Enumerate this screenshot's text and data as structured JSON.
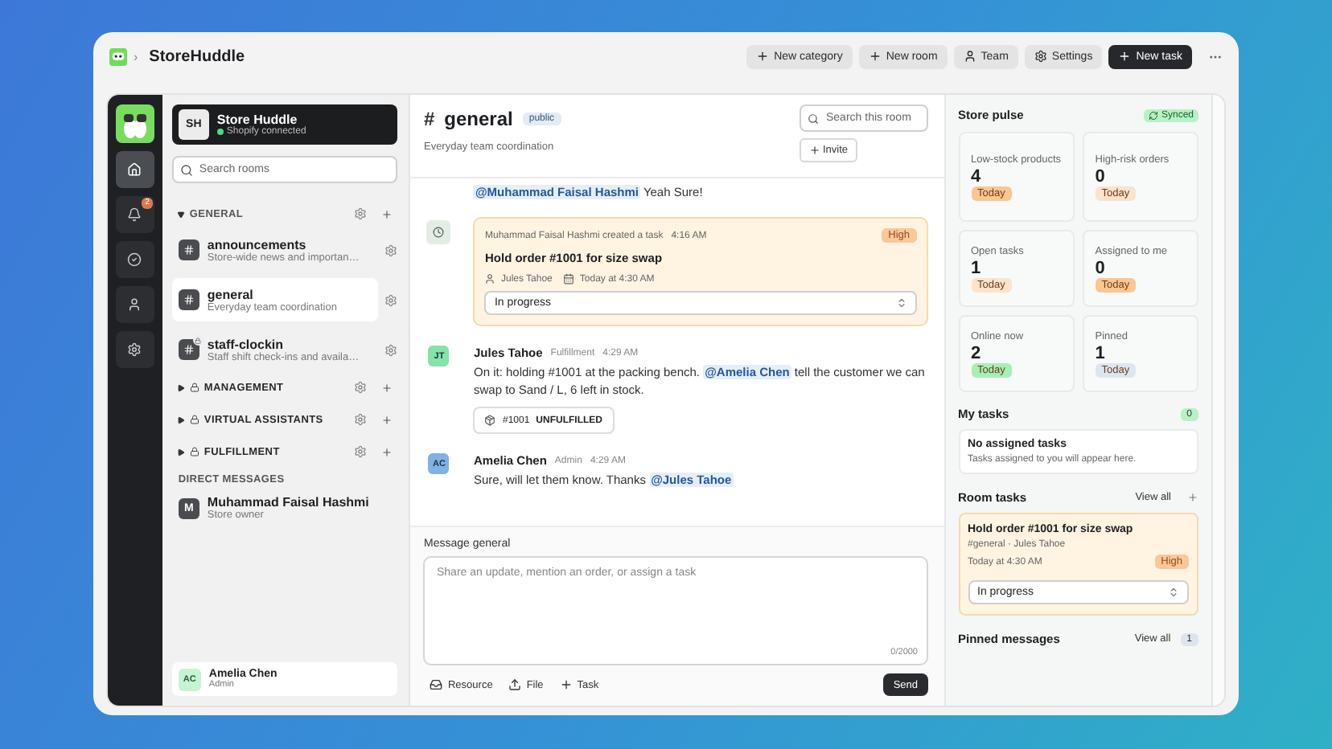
{
  "app": {
    "name": "StoreHuddle",
    "separator": "›"
  },
  "header_actions": [
    {
      "label": "New category",
      "kind": "secondary"
    },
    {
      "label": "New room",
      "kind": "secondary"
    },
    {
      "label": "Team",
      "kind": "secondary"
    },
    {
      "label": "Settings",
      "kind": "secondary"
    },
    {
      "label": "New task",
      "kind": "primary"
    }
  ],
  "rail": [
    {
      "selected": true
    },
    {
      "selected": false,
      "badge": "2"
    },
    {
      "selected": false
    },
    {
      "selected": false
    },
    {
      "selected": false
    }
  ],
  "workspace": {
    "initials": "SH",
    "name": "Store Huddle",
    "status": "Shopify connected",
    "connected": true
  },
  "sidebar": {
    "search_placeholder": "Search rooms",
    "categories": [
      {
        "name": "GENERAL",
        "expanded": true,
        "locked": false,
        "rooms": [
          {
            "name": "announcements",
            "description": "Store-wide news and importan…",
            "selected": false,
            "locked": false
          },
          {
            "name": "general",
            "description": "Everyday team coordination",
            "selected": true,
            "locked": false
          },
          {
            "name": "staff-clockin",
            "description": "Staff shift check-ins and availa…",
            "selected": false,
            "locked": true
          }
        ]
      },
      {
        "name": "MANAGEMENT",
        "expanded": false,
        "locked": true
      },
      {
        "name": "VIRTUAL ASSISTANTS",
        "expanded": false,
        "locked": true
      },
      {
        "name": "FULFILLMENT",
        "expanded": false,
        "locked": true
      }
    ],
    "dm_heading": "DIRECT MESSAGES",
    "dms": [
      {
        "initial": "M",
        "name": "Muhammad Faisal Hashmi",
        "role": "Store owner"
      }
    ]
  },
  "current_user": {
    "initials": "AC",
    "name": "Amelia Chen",
    "role": "Admin"
  },
  "channel": {
    "prefix": "#",
    "name": "general",
    "visibility": "public",
    "description": "Everyday team coordination",
    "search_placeholder": "Search this room",
    "invite_label": "Invite"
  },
  "messages": [
    {
      "kind": "continuation",
      "segments": [
        {
          "mention": "@Muhammad Faisal Hashmi"
        },
        {
          "text": " Yeah Sure!"
        }
      ]
    },
    {
      "kind": "task",
      "author": "Muhammad Faisal Hashmi",
      "action": "created a task",
      "time": "4:16 AM",
      "priority": "High",
      "title": "Hold order #1001 for size swap",
      "assignee": "Jules Tahoe",
      "due": "Today at 4:30 AM",
      "status": "In progress"
    },
    {
      "kind": "message",
      "initials": "JT",
      "color": "#86e3a8",
      "author": "Jules Tahoe",
      "role": "Fulfillment",
      "time": "4:29 AM",
      "segments": [
        {
          "text": "On it: holding #1001 at the packing bench. "
        },
        {
          "mention": "@Amelia Chen"
        },
        {
          "text": " tell the customer we can swap to Sand / L, 6 left in stock."
        }
      ],
      "attachment": {
        "order": "#1001",
        "status": "UNFULFILLED"
      }
    },
    {
      "kind": "message",
      "initials": "AC",
      "color": "#7fb2e5",
      "author": "Amelia Chen",
      "role": "Admin",
      "time": "4:29 AM",
      "segments": [
        {
          "text": "Sure, will let them know. Thanks "
        },
        {
          "mention": "@Jules Tahoe"
        }
      ]
    }
  ],
  "composer": {
    "label": "Message general",
    "placeholder": "Share an update, mention an order, or assign a task",
    "counter": "0/2000",
    "tools": [
      {
        "label": "Resource"
      },
      {
        "label": "File"
      },
      {
        "label": "Task"
      }
    ],
    "send_label": "Send"
  },
  "pulse": {
    "title": "Store pulse",
    "sync_label": "Synced",
    "stats": [
      {
        "label": "Low-stock products",
        "value": "4",
        "tag": "Today",
        "color": "#fcc690"
      },
      {
        "label": "High-risk orders",
        "value": "0",
        "tag": "Today",
        "color": "#fde2cc"
      },
      {
        "label": "Open tasks",
        "value": "1",
        "tag": "Today",
        "color": "#fde2cc"
      },
      {
        "label": "Assigned to me",
        "value": "0",
        "tag": "Today",
        "color": "#fcc690"
      },
      {
        "label": "Online now",
        "value": "2",
        "tag": "Today",
        "color": "#a7f0b5"
      },
      {
        "label": "Pinned",
        "value": "1",
        "tag": "Today",
        "color": "#dde6f0"
      }
    ]
  },
  "my_tasks": {
    "title": "My tasks",
    "count": "0",
    "empty_title": "No assigned tasks",
    "empty_text": "Tasks assigned to you will appear here."
  },
  "room_tasks": {
    "title": "Room tasks",
    "view_all": "View all",
    "tasks": [
      {
        "title": "Hold order #1001 for size swap",
        "meta": "#general · Jules Tahoe",
        "due": "Today at 4:30 AM",
        "priority": "High",
        "status": "In progress"
      }
    ]
  },
  "pinned": {
    "title": "Pinned messages",
    "view_all": "View all",
    "count": "1"
  }
}
